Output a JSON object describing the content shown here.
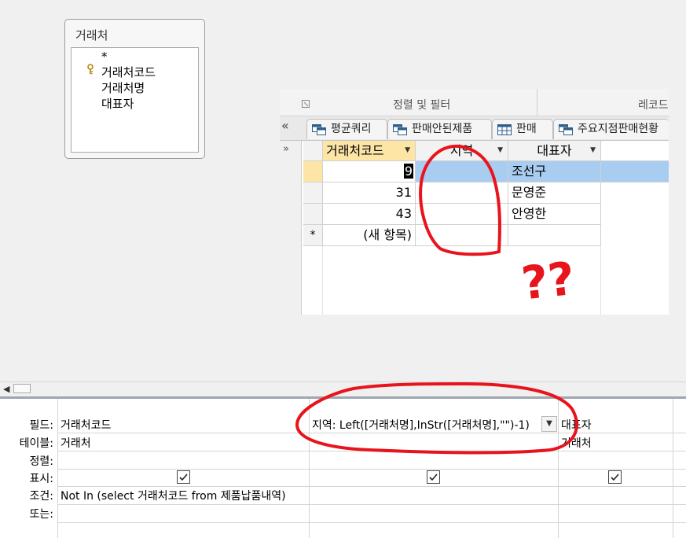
{
  "table_box": {
    "title": "거래처",
    "fields": [
      "*",
      "거래처코드",
      "거래처명",
      "대표자"
    ]
  },
  "ribbon": {
    "sort_filter_label": "정렬 및 필터",
    "records_label": "레코드"
  },
  "tabs": [
    {
      "label": "평균쿼리",
      "icon": "query-icon"
    },
    {
      "label": "판매안된제품",
      "icon": "query-icon"
    },
    {
      "label": "판매",
      "icon": "table-icon"
    },
    {
      "label": "주요지점판매현황",
      "icon": "query-icon"
    }
  ],
  "datasheet": {
    "columns": [
      "거래처코드",
      "지역",
      "대표자"
    ],
    "rows": [
      {
        "code": "9",
        "region": "",
        "rep": "조선구"
      },
      {
        "code": "31",
        "region": "",
        "rep": "문영준"
      },
      {
        "code": "43",
        "region": "",
        "rep": "안영한"
      }
    ],
    "new_row_marker": "*",
    "new_row_label": "(새 항목)"
  },
  "annotation_text": "??",
  "query_grid": {
    "row_labels": [
      "필드:",
      "테이블:",
      "정렬:",
      "표시:",
      "조건:",
      "또는:"
    ],
    "columns": [
      {
        "field": "거래처코드",
        "table": "거래처",
        "criteria": "Not In (select 거래처코드 from 제품납품내역)",
        "show": true
      },
      {
        "field": "지역: Left([거래처명],InStr([거래처명],\"\")-1)",
        "table": "",
        "criteria": "",
        "show": true
      },
      {
        "field": "대표자",
        "table": "거래처",
        "criteria": "",
        "show": true
      }
    ]
  },
  "colors": {
    "selected_row": "#a9cdf0",
    "selected_header": "#fde5a6",
    "annotation_red": "#e8141c"
  }
}
